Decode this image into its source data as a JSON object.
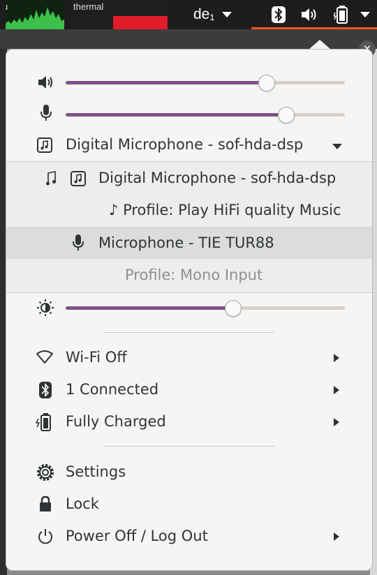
{
  "topbar": {
    "cpu_graph_label": "u",
    "thermal_graph_label": "thermal",
    "keyboard_layout": "de₁",
    "icons": [
      "bluetooth-icon",
      "volume-icon",
      "battery-icon",
      "chevron-down-icon"
    ],
    "accent_color": "#e95420"
  },
  "menu": {
    "volume": {
      "icon": "speaker-icon",
      "level_percent": 72
    },
    "microphone": {
      "icon": "microphone-icon",
      "level_percent": 79
    },
    "input_selector": {
      "label": "Digital Microphone - sof-hda-dsp",
      "icon": "audio-card-icon",
      "expanded": true,
      "items": [
        {
          "label": "Digital Microphone - sof-hda-dsp",
          "icon": "audio-card-icon",
          "current": true
        },
        {
          "label": "♪ Profile: Play HiFi quality Music",
          "kind": "profile"
        },
        {
          "label": "Microphone - TIE TUR88",
          "icon": "microphone-icon",
          "highlighted": true
        },
        {
          "label": "Profile: Mono Input",
          "kind": "profile",
          "disabled": true
        }
      ]
    },
    "brightness": {
      "icon": "brightness-icon",
      "level_percent": 60
    },
    "wifi": {
      "label": "Wi-Fi Off",
      "icon": "wifi-icon"
    },
    "bluetooth": {
      "label": "1 Connected",
      "icon": "bluetooth-icon"
    },
    "battery": {
      "label": "Fully Charged",
      "icon": "battery-icon"
    },
    "settings": {
      "label": "Settings",
      "icon": "settings-icon"
    },
    "lock": {
      "label": "Lock",
      "icon": "lock-icon"
    },
    "power": {
      "label": "Power Off / Log Out",
      "icon": "power-icon"
    },
    "slider_fill_color": "#7e5286"
  }
}
